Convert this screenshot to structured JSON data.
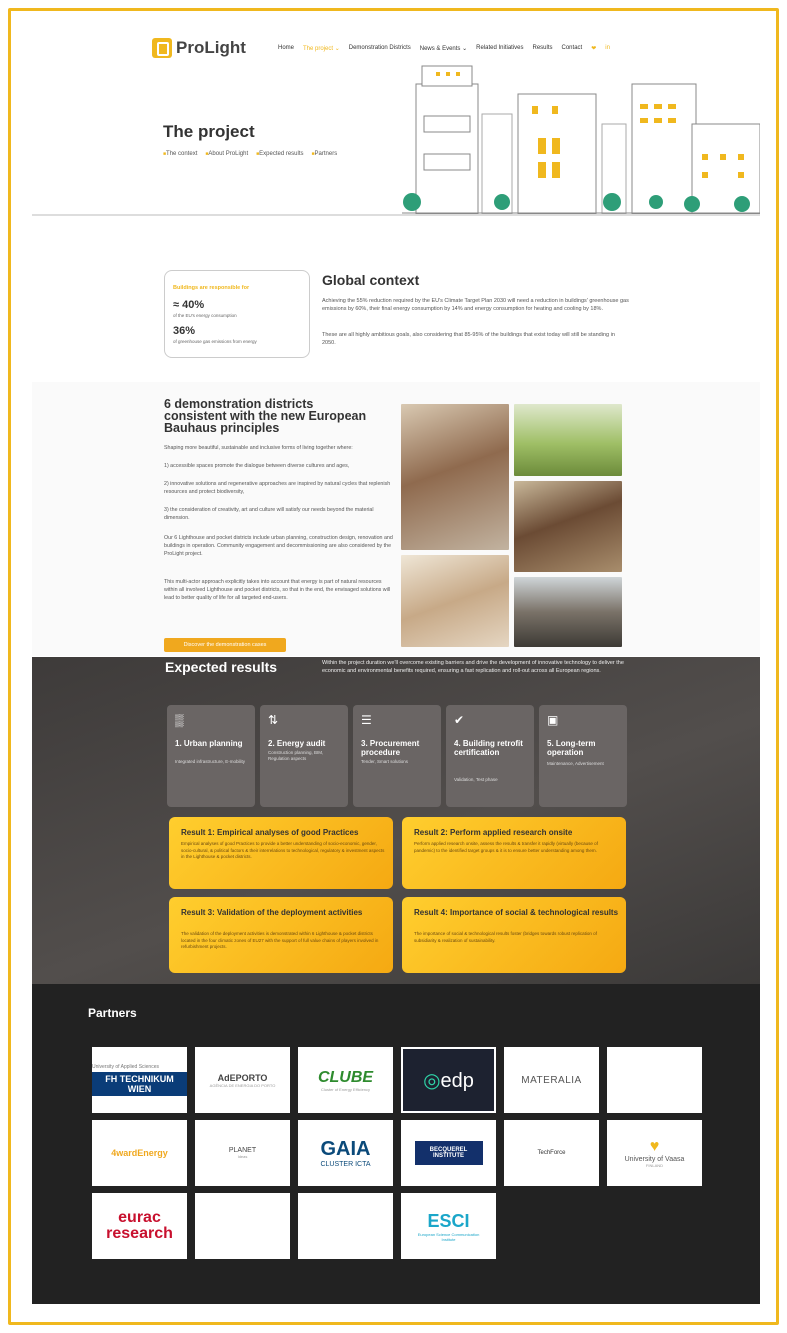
{
  "header": {
    "logo": "ProLight",
    "nav": [
      "Home",
      "The project",
      "Demonstration Districts",
      "News & Events",
      "Related Initiatives",
      "Results",
      "Contact"
    ],
    "social": [
      "❤",
      "in"
    ],
    "title": "The project",
    "breadcrumbs": [
      "The context",
      "About ProLight",
      "Expected results",
      "Partners"
    ]
  },
  "context": {
    "box_label": "Buildings are responsible for",
    "stat1": "≈ 40%",
    "stat1_desc": "of the EU's energy consumption",
    "stat2": "36%",
    "stat2_desc": "of greenhouse gas emissions from energy",
    "heading": "Global context",
    "p1": "Achieving the 55% reduction required by the EU's Climate Target Plan 2030 will need a reduction in buildings' greenhouse gas emissions by 60%, their final energy consumption by 14% and energy consumption for heating and cooling by 18%.",
    "p2": "These are all highly ambitious goals, also considering that 85-95% of the buildings that exist today will still be standing in 2050."
  },
  "demo": {
    "heading": "6 demonstration districts consistent with the new European Bauhaus principles",
    "p1": "Shaping more beautiful, sustainable and inclusive forms of living together where:",
    "p2": "1) accessible spaces promote the dialogue between diverse cultures and ages,",
    "p3": "2) innovative solutions and regenerative approaches are inspired by natural cycles that replenish resources and protect biodiversity,",
    "p4": "3) the consideration of creativity, art and culture will satisfy our needs beyond the material dimension.",
    "p5": "Our 6 Lighthouse and pocket districts include urban planning, construction design, renovation and buildings in operation. Community engagement and decommissioning are also considered by the ProLight project.",
    "p6": "This multi-actor approach explicitly takes into account that energy is part of natural resources within all involved Lighthouse and pocket districts, so that in the end, the envisaged solutions will lead to better quality of life for all targeted end-users.",
    "button": "Discover the demonstration cases"
  },
  "expected": {
    "heading": "Expected results",
    "intro": "Within the project duration we'll overcome existing barriers and drive the development of innovative technology to deliver the economic and environmental benefits required, ensuring a fast replication and roll-out across all European regions.",
    "cards": [
      {
        "icon": "▒",
        "title": "1. Urban planning",
        "sub": "Integrated infrastructure, E-mobility"
      },
      {
        "icon": "⇅",
        "title": "2. Energy audit",
        "sub": "Construction planning, BIM, Regulation aspects"
      },
      {
        "icon": "☰",
        "title": "3. Procurement procedure",
        "sub": "Tender, Smart solutions"
      },
      {
        "icon": "✔",
        "title": "4. Building retrofit certification",
        "sub": "Validation, Test phase"
      },
      {
        "icon": "▣",
        "title": "5. Long-term operation",
        "sub": "Maintenance, Advertisement"
      }
    ],
    "results": [
      {
        "title": "Result 1: Empirical analyses of good Practices",
        "desc": "Empirical analyses of good Practices to provide a better understanding of socio-economic, gender, socio-cultural, & political factors & their interrelations to technological, regulatory & investment aspects in the Lighthouse & pocket districts."
      },
      {
        "title": "Result 2: Perform applied research onsite",
        "desc": "Perform applied research onsite, assess the results & transfer it rapidly (virtually (because of pandemic) to the identified target groups & it is to ensure better understanding among them."
      },
      {
        "title": "Result 3: Validation of the deployment activities",
        "desc": "The validation of the deployment activities is demonstrated within 6 Lighthouse & pocket districts located in the four climatic zones of EU27 with the support of full value chains of players involved in refurbishment projects."
      },
      {
        "title": "Result 4: Importance of social & technological results",
        "desc": "The importance of social & technological results foster (bridges towards robust replication of subsidiarity & realization of sustainability."
      }
    ]
  },
  "partners": {
    "heading": "Partners",
    "logos": [
      {
        "name": "FH TECHNIKUM WIEN",
        "sub": "University of Applied Sciences"
      },
      {
        "name": "AdEPORTO",
        "sub": "AGÊNCIA DE ENERGIA DO PORTO"
      },
      {
        "name": "CLUBE",
        "sub": "Cluster of Energy Efficiency"
      },
      {
        "name": "edp",
        "sub": ""
      },
      {
        "name": "MATERALIA",
        "sub": ""
      },
      {
        "name": "",
        "sub": ""
      },
      {
        "name": "4wardEnergy",
        "sub": ""
      },
      {
        "name": "PLANET",
        "sub": "Ideas"
      },
      {
        "name": "GAIA",
        "sub": "CLUSTER ICTA"
      },
      {
        "name": "BECQUEREL INSTITUTE",
        "sub": ""
      },
      {
        "name": "TechForce",
        "sub": ""
      },
      {
        "name": "University of Vaasa",
        "sub": "FINLAND"
      },
      {
        "name": "eurac research",
        "sub": ""
      },
      {
        "name": "",
        "sub": ""
      },
      {
        "name": "",
        "sub": ""
      },
      {
        "name": "ESCI",
        "sub": "European Science Communication Institute"
      }
    ]
  },
  "colors": {
    "accent": "#f0b81e",
    "dark": "#222222",
    "card": "#6a6564"
  }
}
